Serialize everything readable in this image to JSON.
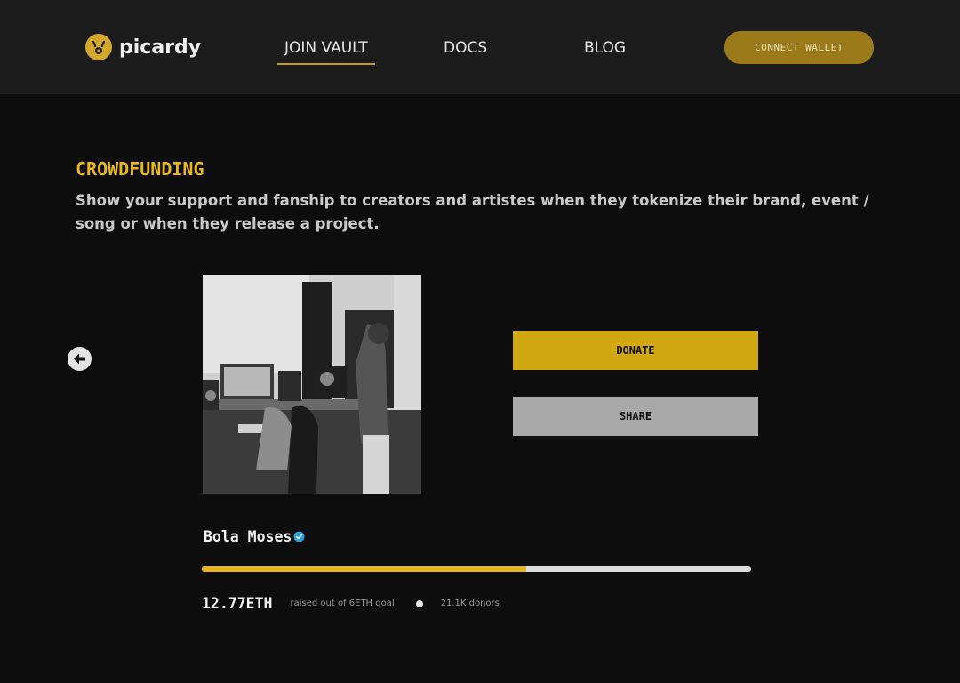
{
  "header": {
    "logo_text": "picardy",
    "nav": [
      {
        "label": "JOIN VAULT",
        "active": true
      },
      {
        "label": "DOCS",
        "active": false
      },
      {
        "label": "BLOG",
        "active": false
      }
    ],
    "connect_label": "CONNECT WALLET"
  },
  "colors": {
    "accent": "#d1a712",
    "background": "#0d0d0d",
    "header_bg": "#1c1c1c",
    "share_button": "#a9a9a9",
    "verified_badge": "#2a9fd8"
  },
  "section": {
    "title": "CROWDFUNDING",
    "description": "Show your support and fanship to creators and artistes when they tokenize their brand, event / song or when they release a project."
  },
  "campaign": {
    "prev_icon": "arrow-left-icon",
    "donate_label": "DONATE",
    "share_label": "SHARE",
    "creator_name": "Bola Moses",
    "verified_icon": "verified-check-icon",
    "progress_fraction": 0.59,
    "raised_amount": "12.77ETH",
    "raised_caption": "raised out of 6ETH goal",
    "donors": "21.1K donors"
  }
}
